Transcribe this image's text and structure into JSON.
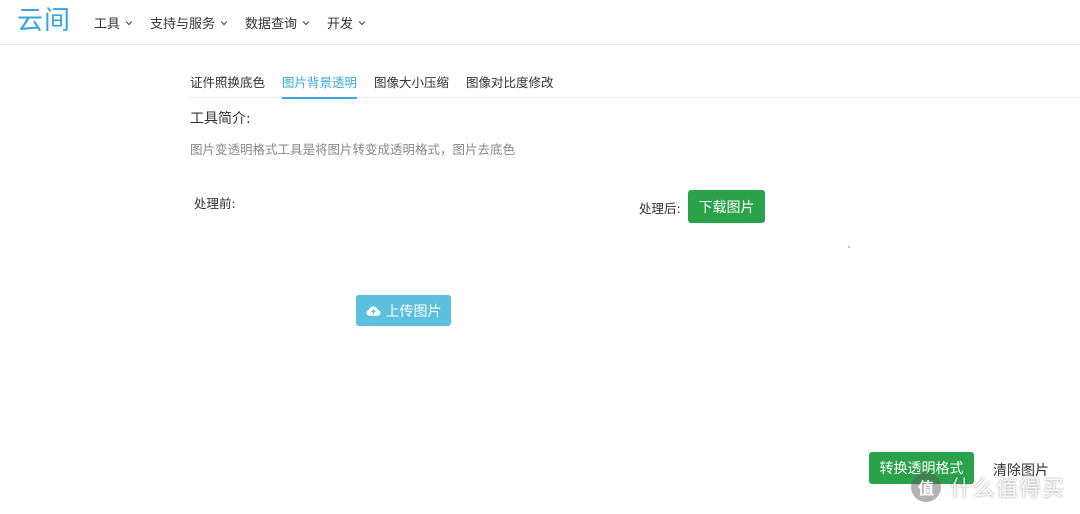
{
  "app": {
    "logo": "云间",
    "brand_color": "#35a6dd"
  },
  "nav": {
    "items": [
      {
        "label": "工具"
      },
      {
        "label": "支持与服务"
      },
      {
        "label": "数据查询"
      },
      {
        "label": "开发"
      }
    ]
  },
  "tabs": {
    "items": [
      {
        "label": "证件照换底色"
      },
      {
        "label": "图片背景透明",
        "active": true
      },
      {
        "label": "图像大小压缩"
      },
      {
        "label": "图像对比度修改"
      }
    ],
    "active_color": "#39a9d9"
  },
  "intro": {
    "title": "工具简介:",
    "description": "图片变透明格式工具是将图片转变成透明格式，图片去底色"
  },
  "panels": {
    "before_label": "处理前:",
    "after_label": "处理后:",
    "download_label": "下载图片",
    "upload_label": "上传图片"
  },
  "actions": {
    "convert_label": "转换透明格式",
    "clear_label": "清除图片"
  },
  "colors": {
    "success": "#2aa24a",
    "info": "#5bc0de"
  },
  "watermark": {
    "logo_text": "值",
    "text": "什么值得买"
  }
}
